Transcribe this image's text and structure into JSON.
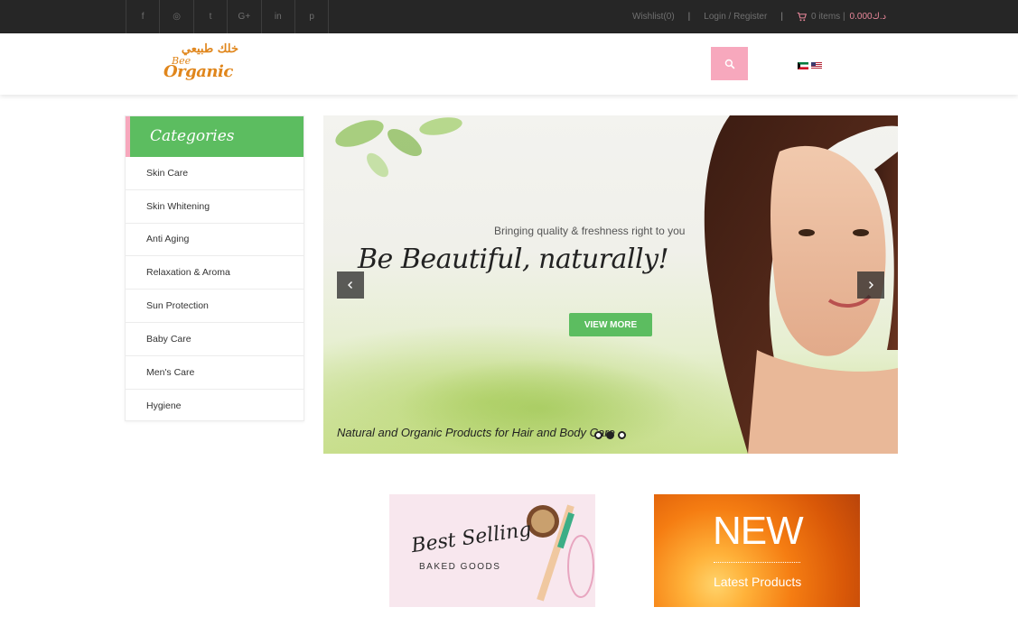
{
  "topbar": {
    "social": [
      {
        "name": "facebook",
        "glyph": "f"
      },
      {
        "name": "instagram",
        "glyph": "◎"
      },
      {
        "name": "twitter",
        "glyph": "t"
      },
      {
        "name": "google-plus",
        "glyph": "G+"
      },
      {
        "name": "linkedin",
        "glyph": "in"
      },
      {
        "name": "pinterest",
        "glyph": "p"
      }
    ],
    "wishlist": "Wishlist(0)",
    "separator": "|",
    "login": "Login / Register",
    "cart_items": "0 items |",
    "cart_amount": "0.000د.ك"
  },
  "header": {
    "logo_arabic": "خلك طبيعي",
    "logo_line1": "Bee",
    "logo_line2": "Organic",
    "search_icon": "search-icon",
    "flags": [
      "kuwait-flag",
      "us-flag"
    ]
  },
  "categories": {
    "title": "Categories",
    "items": [
      "Skin Care",
      "Skin Whitening",
      "Anti Aging",
      "Relaxation & Aroma",
      "Sun Protection",
      "Baby Care",
      "Men's Care",
      "Hygiene"
    ]
  },
  "slider": {
    "tagline": "Bringing quality & freshness right to you",
    "headline": "Be Beautiful, naturally!",
    "button": "VIEW MORE",
    "bottom_text": "Natural and Organic Products for Hair and Body Care",
    "dots": 3,
    "active_dot": 1
  },
  "banners": {
    "best_selling_title": "Best Selling",
    "best_selling_sub": "BAKED GOODS",
    "new_title": "NEW",
    "new_sub": "Latest Products"
  },
  "colors": {
    "accent_green": "#5cbd60",
    "accent_pink": "#f7a8bd",
    "topbar": "#262626"
  }
}
